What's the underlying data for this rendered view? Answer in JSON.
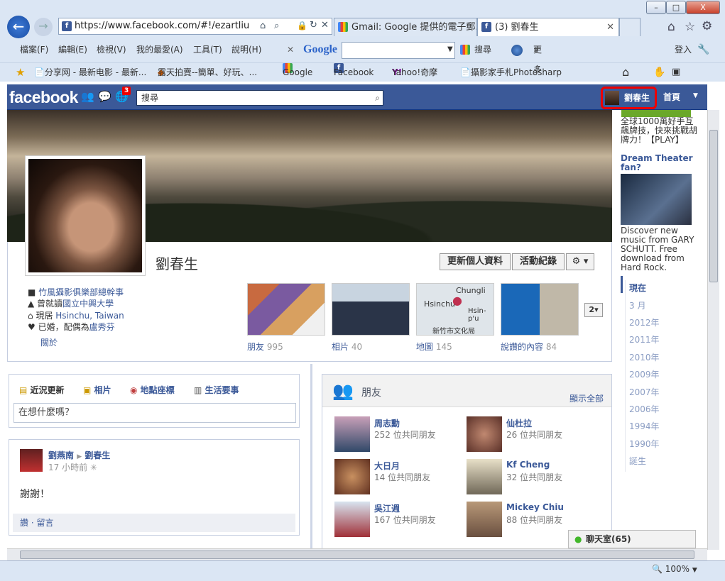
{
  "browser": {
    "address": "https://www.facebook.com/#!/ezartliu",
    "tabs": [
      "Gmail: Google 提供的電子郵...",
      "(3) 劉春生"
    ],
    "menu": [
      "檔案(F)",
      "編輯(E)",
      "檢視(V)",
      "我的最愛(A)",
      "工具(T)",
      "說明(H)"
    ],
    "google_label": "Google",
    "search_label": "搜尋",
    "more_settings": "更多設定",
    "login": "登入",
    "favorites": [
      "分享网 - 最新电影 - 最新...",
      "露天拍賣--簡單、好玩、...",
      "Google",
      "Facebook",
      "Yahoo!奇摩",
      "攝影家手札Photosharp"
    ],
    "zoom": "100%",
    "win_controls": [
      "–",
      "□",
      "X"
    ]
  },
  "fb": {
    "logo": "facebook",
    "notif_count": "3",
    "search_placeholder": "搜尋",
    "user_name": "劉春生",
    "home": "首頁"
  },
  "profile": {
    "name": "劉春生",
    "edit_button": "更新個人資料",
    "activity_button": "活動紀錄",
    "info": [
      {
        "text": "竹風攝影俱樂部總幹事",
        "link": ""
      },
      {
        "text": "曾就讀",
        "link": "國立中興大學"
      },
      {
        "text": "現居 ",
        "link": "Hsinchu, Taiwan"
      },
      {
        "text": "已婚，配偶為",
        "link": "盧秀芬"
      }
    ],
    "about": "關於",
    "tiles": [
      {
        "label": "朋友",
        "count": "995"
      },
      {
        "label": "相片",
        "count": "40"
      },
      {
        "label": "地圖",
        "count": "145"
      },
      {
        "label": "說讚的內容",
        "count": "84"
      }
    ],
    "map_labels": [
      "Chungli",
      "Hsinchu",
      "Hsin-p'u",
      "新竹市文化局"
    ],
    "more_count": "2"
  },
  "composer": {
    "tabs": [
      "近況更新",
      "相片",
      "地點座標",
      "生活要事"
    ],
    "placeholder": "在想什麼嗎？"
  },
  "post": {
    "author": "劉燕南",
    "target": "劉春生",
    "time": "17 小時前",
    "body": "謝謝！",
    "like": "讚",
    "comment": "留言"
  },
  "friends_panel": {
    "title": "朋友",
    "show_all": "顯示全部",
    "items": [
      {
        "name": "周志勳",
        "mutual": "252 位共同朋友"
      },
      {
        "name": "仙杜拉",
        "mutual": "26 位共同朋友"
      },
      {
        "name": "大日月",
        "mutual": "14 位共同朋友"
      },
      {
        "name": "Kf Cheng",
        "mutual": "32 位共同朋友"
      },
      {
        "name": "吳江週",
        "mutual": "167 位共同朋友"
      },
      {
        "name": "Mickey Chiu",
        "mutual": "88 位共同朋友"
      }
    ]
  },
  "ads": {
    "ad1_text": "全球1000萬好手互飆牌技，快來挑戰胡牌力！【PLAY】",
    "ad2_title": "Dream Theater fan?",
    "ad2_text": "Discover new music from GARY SCHUTT. Free download from Hard Rock."
  },
  "timeline_years": [
    "現在",
    "3 月",
    "2012年",
    "2011年",
    "2010年",
    "2009年",
    "2007年",
    "2006年",
    "1994年",
    "1990年",
    "誕生"
  ],
  "chat": {
    "label": "聊天室(65)"
  }
}
